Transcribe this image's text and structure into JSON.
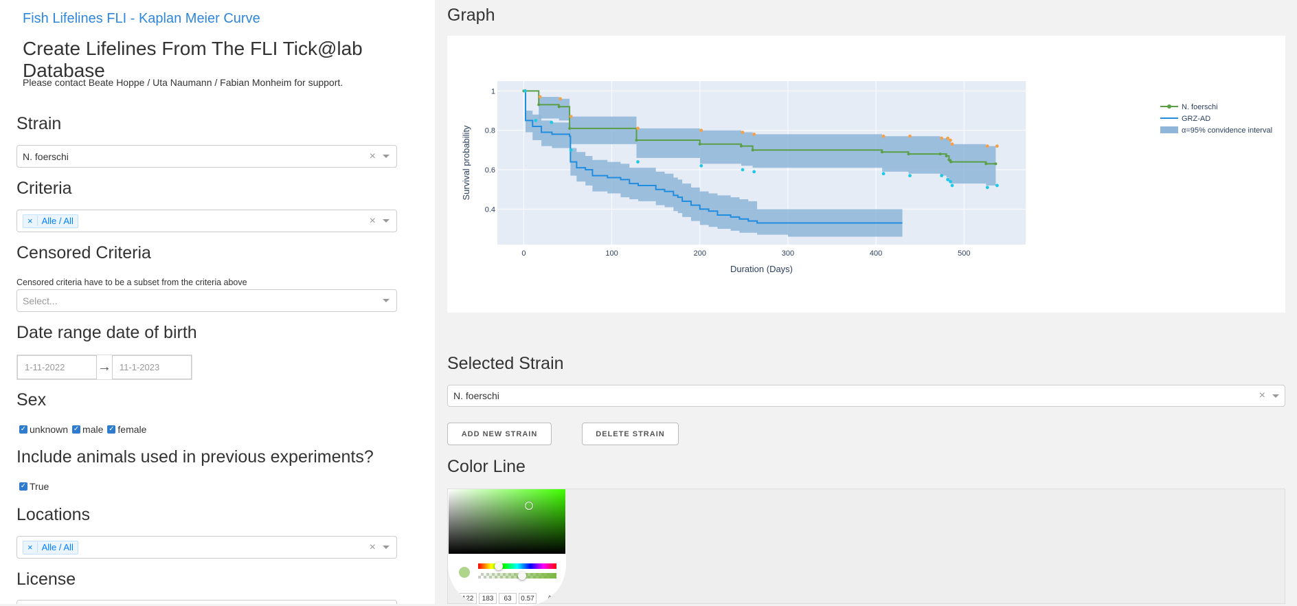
{
  "app": {
    "link_title": "Fish Lifelines FLI - Kaplan Meier Curve",
    "page_title": "Create Lifelines From The FLI Tick@lab Database",
    "support_text": "Please contact Beate Hoppe / Uta Naumann / Fabian Monheim for support."
  },
  "filters": {
    "strain": {
      "heading": "Strain",
      "value": "N. foerschi"
    },
    "criteria": {
      "heading": "Criteria",
      "tag": "Alle / All"
    },
    "censored": {
      "heading": "Censored Criteria",
      "hint": "Censored criteria have to be a subset from the criteria above",
      "placeholder": "Select..."
    },
    "date_range": {
      "heading": "Date range date of birth",
      "start": "1-11-2022",
      "end": "11-1-2023",
      "arrow": "→"
    },
    "sex": {
      "heading": "Sex",
      "options": [
        "unknown",
        "male",
        "female"
      ]
    },
    "previous": {
      "heading": "Include animals used in previous experiments?",
      "option": "True"
    },
    "locations": {
      "heading": "Locations",
      "tag": "Alle / All"
    },
    "license": {
      "heading": "License"
    }
  },
  "graph": {
    "heading": "Graph"
  },
  "selected_strain": {
    "heading": "Selected Strain",
    "value": "N. foerschi",
    "add_button": "ADD NEW STRAIN",
    "delete_button": "DELETE STRAIN"
  },
  "color_line": {
    "heading": "Color Line",
    "rgba": [
      "122",
      "183",
      "63",
      "0.57"
    ],
    "caret": "^"
  },
  "colors": {
    "link": "#2e86de",
    "series_1": "#5a9e45",
    "series_2": "#1f8ce0",
    "ci_fill": "#8fb6d8",
    "plot_bg": "#e5ecf6",
    "censor_orange": "#f5a04a",
    "censor_cyan": "#1ec8e8"
  },
  "chart_data": {
    "type": "line",
    "subtype": "kaplan-meier step",
    "xlabel": "Duration (Days)",
    "ylabel": "Survival probability",
    "xlim": [
      -30,
      570
    ],
    "ylim": [
      0.22,
      1.05
    ],
    "xticks": [
      0,
      100,
      200,
      300,
      400,
      500
    ],
    "yticks": [
      0.4,
      0.6,
      0.8,
      1
    ],
    "ytick_labels": [
      "0.4",
      "0.6",
      "0.8",
      "1"
    ],
    "legend": [
      "N. foerschi",
      "GRZ-AD",
      "α=95% convidence interval"
    ],
    "legend_position": "top-right",
    "series": [
      {
        "name": "N. foerschi",
        "color": "#5a9e45",
        "steps": [
          [
            0,
            1.0
          ],
          [
            17,
            0.93
          ],
          [
            40,
            0.92
          ],
          [
            52,
            0.81
          ],
          [
            128,
            0.75
          ],
          [
            200,
            0.73
          ],
          [
            247,
            0.72
          ],
          [
            260,
            0.7
          ],
          [
            407,
            0.69
          ],
          [
            437,
            0.68
          ],
          [
            473,
            0.68
          ],
          [
            480,
            0.67
          ],
          [
            483,
            0.65
          ],
          [
            485,
            0.64
          ],
          [
            525,
            0.63
          ],
          [
            536,
            0.63
          ]
        ],
        "ci_upper": [
          [
            0,
            1.0
          ],
          [
            17,
            0.97
          ],
          [
            40,
            0.96
          ],
          [
            52,
            0.87
          ],
          [
            128,
            0.81
          ],
          [
            200,
            0.8
          ],
          [
            247,
            0.79
          ],
          [
            260,
            0.78
          ],
          [
            407,
            0.77
          ],
          [
            437,
            0.77
          ],
          [
            473,
            0.76
          ],
          [
            483,
            0.75
          ],
          [
            485,
            0.73
          ],
          [
            525,
            0.72
          ],
          [
            536,
            0.72
          ]
        ],
        "ci_lower": [
          [
            0,
            1.0
          ],
          [
            17,
            0.86
          ],
          [
            40,
            0.85
          ],
          [
            52,
            0.73
          ],
          [
            128,
            0.66
          ],
          [
            200,
            0.63
          ],
          [
            247,
            0.62
          ],
          [
            260,
            0.61
          ],
          [
            407,
            0.59
          ],
          [
            437,
            0.58
          ],
          [
            473,
            0.57
          ],
          [
            480,
            0.56
          ],
          [
            483,
            0.54
          ],
          [
            485,
            0.53
          ],
          [
            525,
            0.52
          ],
          [
            536,
            0.52
          ]
        ],
        "censored_x": [
          0,
          17,
          40,
          52,
          128,
          200,
          247,
          260,
          407,
          437,
          473,
          480,
          483,
          485,
          525,
          536
        ]
      },
      {
        "name": "GRZ-AD",
        "color": "#1f8ce0",
        "steps": [
          [
            0,
            1.0
          ],
          [
            2,
            0.85
          ],
          [
            10,
            0.82
          ],
          [
            20,
            0.79
          ],
          [
            32,
            0.78
          ],
          [
            52,
            0.77
          ],
          [
            53,
            0.64
          ],
          [
            60,
            0.61
          ],
          [
            70,
            0.6
          ],
          [
            78,
            0.57
          ],
          [
            95,
            0.56
          ],
          [
            110,
            0.55
          ],
          [
            120,
            0.53
          ],
          [
            130,
            0.52
          ],
          [
            150,
            0.5
          ],
          [
            160,
            0.49
          ],
          [
            170,
            0.47
          ],
          [
            175,
            0.46
          ],
          [
            180,
            0.44
          ],
          [
            190,
            0.42
          ],
          [
            200,
            0.4
          ],
          [
            210,
            0.39
          ],
          [
            220,
            0.37
          ],
          [
            235,
            0.36
          ],
          [
            245,
            0.35
          ],
          [
            255,
            0.34
          ],
          [
            265,
            0.33
          ],
          [
            300,
            0.33
          ],
          [
            430,
            0.33
          ]
        ],
        "ci_upper": [
          [
            0,
            1.0
          ],
          [
            2,
            0.9
          ],
          [
            10,
            0.88
          ],
          [
            20,
            0.85
          ],
          [
            32,
            0.84
          ],
          [
            52,
            0.83
          ],
          [
            53,
            0.71
          ],
          [
            60,
            0.69
          ],
          [
            70,
            0.67
          ],
          [
            78,
            0.65
          ],
          [
            95,
            0.64
          ],
          [
            110,
            0.63
          ],
          [
            120,
            0.61
          ],
          [
            130,
            0.61
          ],
          [
            150,
            0.59
          ],
          [
            160,
            0.58
          ],
          [
            170,
            0.56
          ],
          [
            175,
            0.55
          ],
          [
            180,
            0.53
          ],
          [
            190,
            0.51
          ],
          [
            200,
            0.49
          ],
          [
            210,
            0.48
          ],
          [
            220,
            0.47
          ],
          [
            235,
            0.46
          ],
          [
            245,
            0.45
          ],
          [
            255,
            0.44
          ],
          [
            265,
            0.4
          ],
          [
            430,
            0.4
          ]
        ],
        "ci_lower": [
          [
            0,
            1.0
          ],
          [
            2,
            0.79
          ],
          [
            10,
            0.75
          ],
          [
            20,
            0.72
          ],
          [
            32,
            0.71
          ],
          [
            52,
            0.7
          ],
          [
            53,
            0.57
          ],
          [
            60,
            0.54
          ],
          [
            70,
            0.52
          ],
          [
            78,
            0.49
          ],
          [
            95,
            0.48
          ],
          [
            110,
            0.46
          ],
          [
            120,
            0.45
          ],
          [
            130,
            0.44
          ],
          [
            150,
            0.42
          ],
          [
            160,
            0.41
          ],
          [
            170,
            0.39
          ],
          [
            175,
            0.38
          ],
          [
            180,
            0.36
          ],
          [
            190,
            0.34
          ],
          [
            200,
            0.32
          ],
          [
            210,
            0.31
          ],
          [
            220,
            0.3
          ],
          [
            235,
            0.29
          ],
          [
            245,
            0.28
          ],
          [
            255,
            0.28
          ],
          [
            265,
            0.27
          ],
          [
            300,
            0.26
          ],
          [
            430,
            0.26
          ]
        ],
        "censored_x": [
          0,
          12,
          30,
          52,
          128,
          200,
          247,
          260,
          407,
          437,
          473,
          480,
          483,
          485,
          525,
          536
        ],
        "censored_y": [
          1.0,
          0.85,
          0.84,
          0.7,
          0.64,
          0.62,
          0.6,
          0.59,
          0.58,
          0.57,
          0.57,
          0.55,
          0.54,
          0.52,
          0.51,
          0.52
        ]
      }
    ]
  }
}
